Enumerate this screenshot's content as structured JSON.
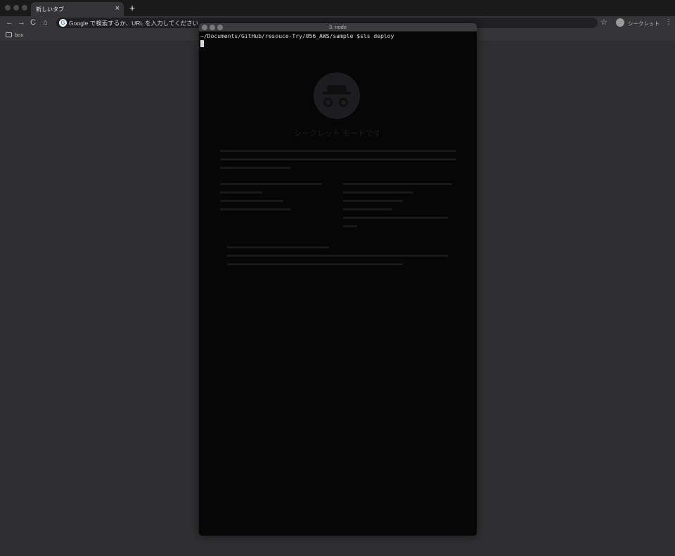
{
  "browser": {
    "tab": {
      "title": "新しいタブ",
      "close": "×"
    },
    "new_tab": "+",
    "nav": {
      "back": "←",
      "forward": "→",
      "reload": "C",
      "home": "⌂"
    },
    "omnibox": {
      "logo_letter": "G",
      "placeholder": "Google で検索するか、URL を入力してください"
    },
    "star": "☆",
    "profile_label": "シークレット",
    "menu": "⋮",
    "bookmark": {
      "label": "box"
    }
  },
  "incognito_page": {
    "title": "シークレット モードです"
  },
  "terminal": {
    "title": "3. node",
    "prompt_line": "~/Documents/GitHub/resouce-Try/056_AWS/sample $sls deploy"
  },
  "colors": {
    "desktop": "#2f2f31",
    "tabstrip": "#1a1a1b",
    "toolbar": "#353537",
    "terminal_bg": "#060607",
    "terminal_text": "#d9d9d9"
  }
}
